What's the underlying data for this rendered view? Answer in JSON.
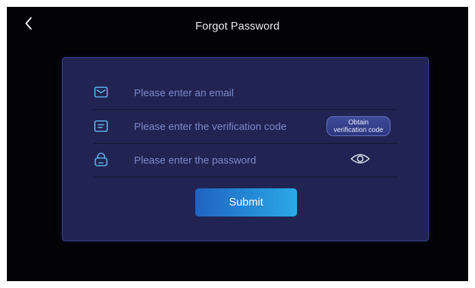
{
  "header": {
    "title": "Forgot Password",
    "back_icon": "chevron-left-icon"
  },
  "form": {
    "email": {
      "icon": "envelope-icon",
      "placeholder": "Please enter an email",
      "value": ""
    },
    "code": {
      "icon": "message-icon",
      "placeholder": "Please enter the verification code",
      "value": "",
      "obtain_label_line1": "Obtain",
      "obtain_label_line2": "verification code"
    },
    "password": {
      "icon": "lock-icon",
      "placeholder": "Please enter the password",
      "value": "",
      "toggle_icon": "eye-icon"
    },
    "submit_label": "Submit"
  },
  "colors": {
    "background": "#030306",
    "card": "#212452",
    "accent_start": "#1f63c2",
    "accent_end": "#2aa9e6",
    "placeholder": "#7d89c9",
    "icon": "#5fb9f0"
  }
}
